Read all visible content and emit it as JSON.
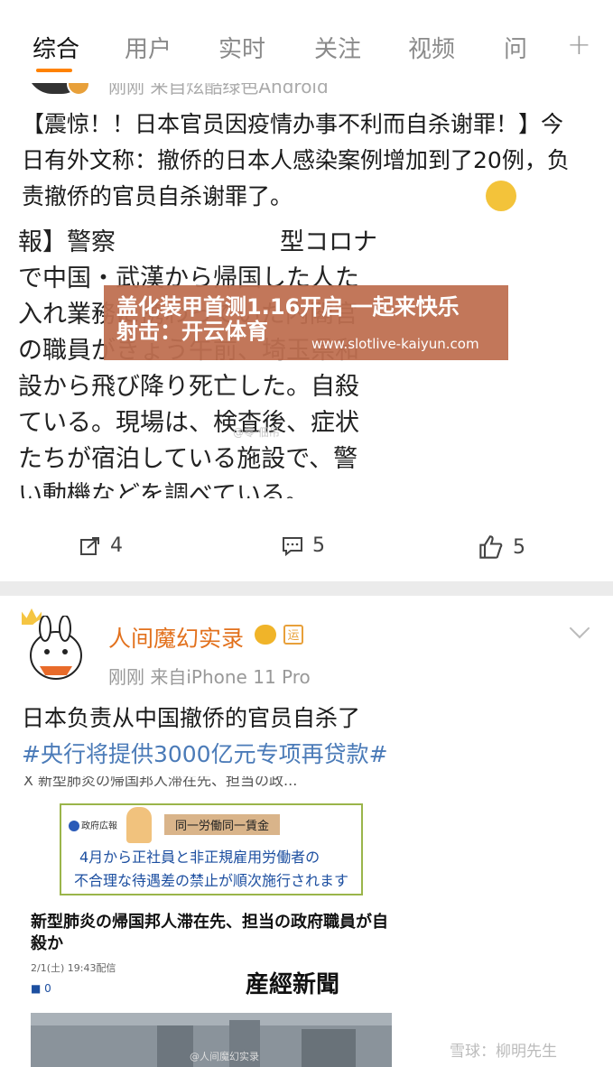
{
  "tabs": [
    "综合",
    "用户",
    "实时",
    "关注",
    "视频",
    "问"
  ],
  "tab_plus": "+",
  "post1": {
    "meta_peek": "刚刚  来自炫酷绿色Android",
    "text": "【震惊！！日本官员因疫情办事不利而自杀谢罪！】今日有外文称：撤侨的日本人感染案例增加到了20例，负责撤侨的官员自杀谢罪了。",
    "jp_lines": [
      "報】警察",
      "で中国・武漢から帰国した人た",
      "入れ業務に携わっていた内閣官",
      "の職員がきょう午前、埼玉県和",
      "設から飛び降り死亡した。自殺",
      "ている。現場は、検査後、症状",
      "たちが宿泊している施設で、警",
      "い動機などを調べている。"
    ],
    "jp_partial": "型コロナ",
    "image_watermark": "@零·佃吊",
    "ad": {
      "line1": "盖化装甲首测1.16开启  一起来快乐",
      "line2": "射击：开云体育",
      "url": "www.slotlive-kaiyun.com"
    },
    "actions": {
      "repost": "4",
      "comment": "5",
      "like": "5"
    }
  },
  "post2": {
    "username": "人间魔幻实录",
    "badge_label": "运",
    "time": "刚刚  来自iPhone 11 Pro",
    "body": "日本负责从中国撤侨的官员自杀了",
    "hashtag": "#央行将提供3000亿元专项再贷款#",
    "news": {
      "top_bar": "X  新型肺炎の帰国邦人滞在先、担当の政...",
      "gov_label": "政府広報",
      "banner_tag": "同一労働同一賃金",
      "banner_line1": "4月から正社員と非正規雇用労働者の",
      "banner_line2": "不合理な待遇差の禁止が順次施行されます",
      "headline": "新型肺炎の帰国邦人滞在先、担当の政府職員が自殺か",
      "date": "2/1(土) 19:43配信",
      "paper": "産經新聞",
      "comment_count": "0",
      "photo_watermark": "@人间魔幻实录"
    }
  },
  "watermark_bottom": "雪球：柳明先生",
  "colors": {
    "accent": "#ff8200",
    "username": "#e2711d",
    "hashtag": "#4b7bb8"
  }
}
